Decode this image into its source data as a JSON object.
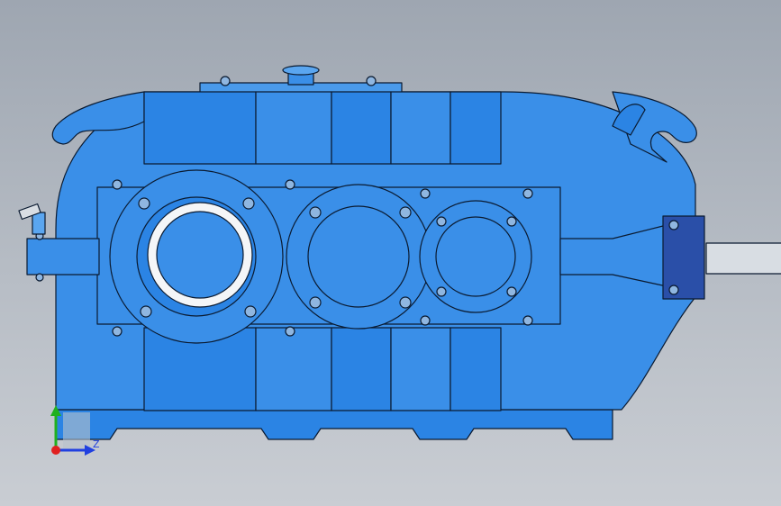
{
  "viewport": {
    "model": "gear-reducer-housing",
    "view": "front",
    "colors": {
      "body": "#3a8fe8",
      "body_dark": "#2277d6",
      "body_light": "#5aa6f0",
      "edge": "#0a1a30",
      "bolt": "#8fb6e0",
      "shaft": "#d8dde3",
      "bearing_dark": "#2a4fa8",
      "background_top": "#9ea6b1",
      "background_bottom": "#c9cdd3"
    }
  },
  "triad": {
    "x_label": "",
    "y_label": "",
    "z_label": "Z",
    "x_color": "#e02020",
    "y_color": "#20b020",
    "z_color": "#2040e0"
  }
}
